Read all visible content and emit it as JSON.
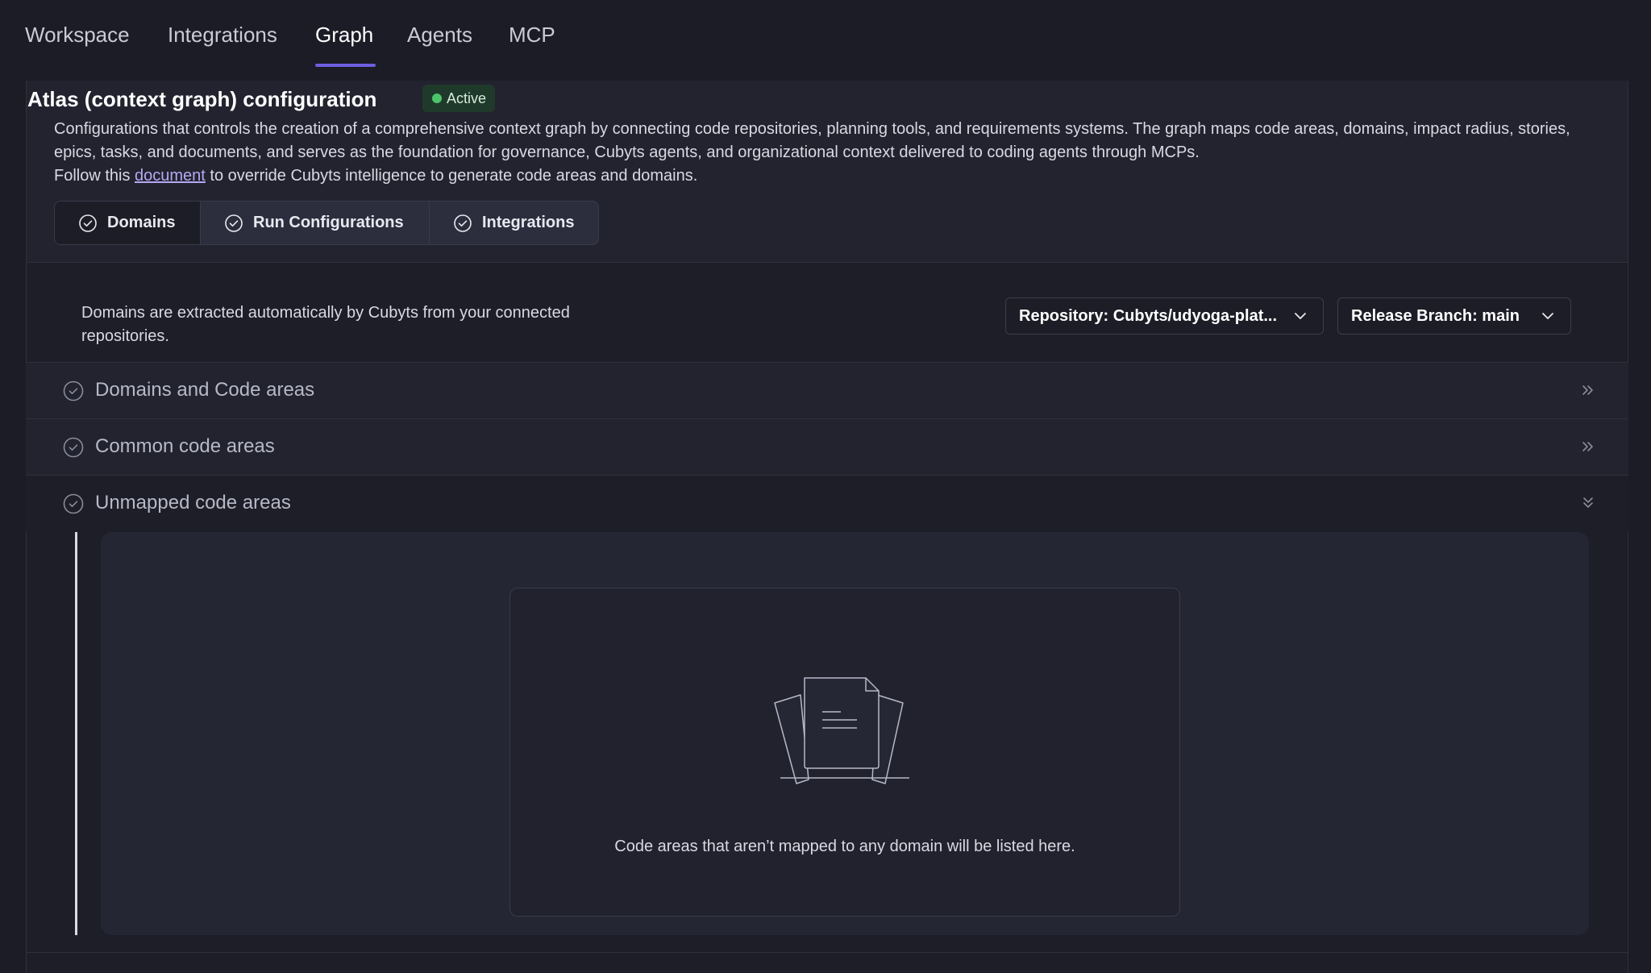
{
  "topnav": {
    "tabs": [
      {
        "label": "Workspace"
      },
      {
        "label": "Integrations"
      },
      {
        "label": "Graph"
      },
      {
        "label": "Agents"
      },
      {
        "label": "MCP"
      }
    ],
    "active": "Graph"
  },
  "header": {
    "title": "Atlas (context graph) configuration",
    "status_badge": "Active",
    "description": "Configurations that controls the creation of a comprehensive context graph by connecting code repositories, planning tools, and requirements systems. The graph maps code areas, domains, impact radius, stories, epics, tasks, and documents, and serves as the foundation for governance, Cubyts agents, and organizational context delivered to coding agents through MCPs.",
    "follow_prefix": "Follow this ",
    "follow_link": "document",
    "follow_suffix": " to override Cubyts intelligence to generate code areas and domains."
  },
  "segments": [
    {
      "label": "Domains"
    },
    {
      "label": "Run Configurations"
    },
    {
      "label": "Integrations"
    }
  ],
  "domains": {
    "info": "Domains are extracted automatically by Cubyts from your connected repositories.",
    "repository_label": "Repository: ",
    "repository_value": "Cubyts/udyoga-plat...",
    "branch_label": "Release Branch: ",
    "branch_value": "main"
  },
  "accordion": [
    {
      "label": "Domains and Code areas"
    },
    {
      "label": "Common code areas"
    },
    {
      "label": "Unmapped code areas"
    }
  ],
  "empty_state": {
    "message": "Code areas that aren’t mapped to any domain will be listed here."
  },
  "colors": {
    "accent": "#6d5fe0",
    "active_green": "#4cc46a",
    "link": "#b6a8f2"
  }
}
